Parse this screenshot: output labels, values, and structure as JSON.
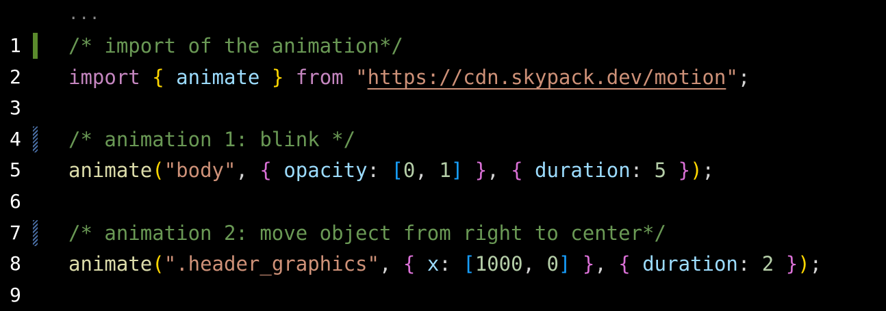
{
  "editor": {
    "fold_indicator": "...",
    "lines": [
      {
        "number": "1",
        "gutter": "added",
        "tokens": [
          {
            "t": "/* import of the animation*/",
            "k": "cm"
          }
        ]
      },
      {
        "number": "2",
        "gutter": "none",
        "tokens": [
          {
            "t": "import",
            "k": "kw"
          },
          {
            "t": " ",
            "k": "p"
          },
          {
            "t": "{",
            "k": "b1"
          },
          {
            "t": " ",
            "k": "p"
          },
          {
            "t": "animate",
            "k": "var"
          },
          {
            "t": " ",
            "k": "p"
          },
          {
            "t": "}",
            "k": "b1"
          },
          {
            "t": " ",
            "k": "p"
          },
          {
            "t": "from",
            "k": "kw"
          },
          {
            "t": " ",
            "k": "p"
          },
          {
            "t": "\"",
            "k": "str"
          },
          {
            "t": "https://cdn.skypack.dev/motion",
            "k": "url"
          },
          {
            "t": "\"",
            "k": "str"
          },
          {
            "t": ";",
            "k": "p"
          }
        ]
      },
      {
        "number": "3",
        "gutter": "none",
        "tokens": []
      },
      {
        "number": "4",
        "gutter": "modified",
        "tokens": [
          {
            "t": "/* animation 1: blink */",
            "k": "cm"
          }
        ]
      },
      {
        "number": "5",
        "gutter": "none",
        "tokens": [
          {
            "t": "animate",
            "k": "fn"
          },
          {
            "t": "(",
            "k": "b1"
          },
          {
            "t": "\"body\"",
            "k": "str"
          },
          {
            "t": ", ",
            "k": "p"
          },
          {
            "t": "{",
            "k": "b2"
          },
          {
            "t": " ",
            "k": "p"
          },
          {
            "t": "opacity",
            "k": "var"
          },
          {
            "t": ": ",
            "k": "p"
          },
          {
            "t": "[",
            "k": "b3"
          },
          {
            "t": "0",
            "k": "num"
          },
          {
            "t": ", ",
            "k": "p"
          },
          {
            "t": "1",
            "k": "num"
          },
          {
            "t": "]",
            "k": "b3"
          },
          {
            "t": " ",
            "k": "p"
          },
          {
            "t": "}",
            "k": "b2"
          },
          {
            "t": ", ",
            "k": "p"
          },
          {
            "t": "{",
            "k": "b2"
          },
          {
            "t": " ",
            "k": "p"
          },
          {
            "t": "duration",
            "k": "var"
          },
          {
            "t": ": ",
            "k": "p"
          },
          {
            "t": "5",
            "k": "num"
          },
          {
            "t": " ",
            "k": "p"
          },
          {
            "t": "}",
            "k": "b2"
          },
          {
            "t": ")",
            "k": "b1"
          },
          {
            "t": ";",
            "k": "p"
          }
        ]
      },
      {
        "number": "6",
        "gutter": "none",
        "tokens": []
      },
      {
        "number": "7",
        "gutter": "modified",
        "tokens": [
          {
            "t": "/* animation 2: move object from right to center*/",
            "k": "cm"
          }
        ]
      },
      {
        "number": "8",
        "gutter": "none",
        "tokens": [
          {
            "t": "animate",
            "k": "fn"
          },
          {
            "t": "(",
            "k": "b1"
          },
          {
            "t": "\".header_graphics\"",
            "k": "str"
          },
          {
            "t": ", ",
            "k": "p"
          },
          {
            "t": "{",
            "k": "b2"
          },
          {
            "t": " ",
            "k": "p"
          },
          {
            "t": "x",
            "k": "var"
          },
          {
            "t": ": ",
            "k": "p"
          },
          {
            "t": "[",
            "k": "b3"
          },
          {
            "t": "1000",
            "k": "num"
          },
          {
            "t": ", ",
            "k": "p"
          },
          {
            "t": "0",
            "k": "num"
          },
          {
            "t": "]",
            "k": "b3"
          },
          {
            "t": " ",
            "k": "p"
          },
          {
            "t": "}",
            "k": "b2"
          },
          {
            "t": ", ",
            "k": "p"
          },
          {
            "t": "{",
            "k": "b2"
          },
          {
            "t": " ",
            "k": "p"
          },
          {
            "t": "duration",
            "k": "var"
          },
          {
            "t": ": ",
            "k": "p"
          },
          {
            "t": "2",
            "k": "num"
          },
          {
            "t": " ",
            "k": "p"
          },
          {
            "t": "}",
            "k": "b2"
          },
          {
            "t": ")",
            "k": "b1"
          },
          {
            "t": ";",
            "k": "p"
          }
        ]
      },
      {
        "number": "9",
        "gutter": "none",
        "tokens": []
      }
    ]
  }
}
